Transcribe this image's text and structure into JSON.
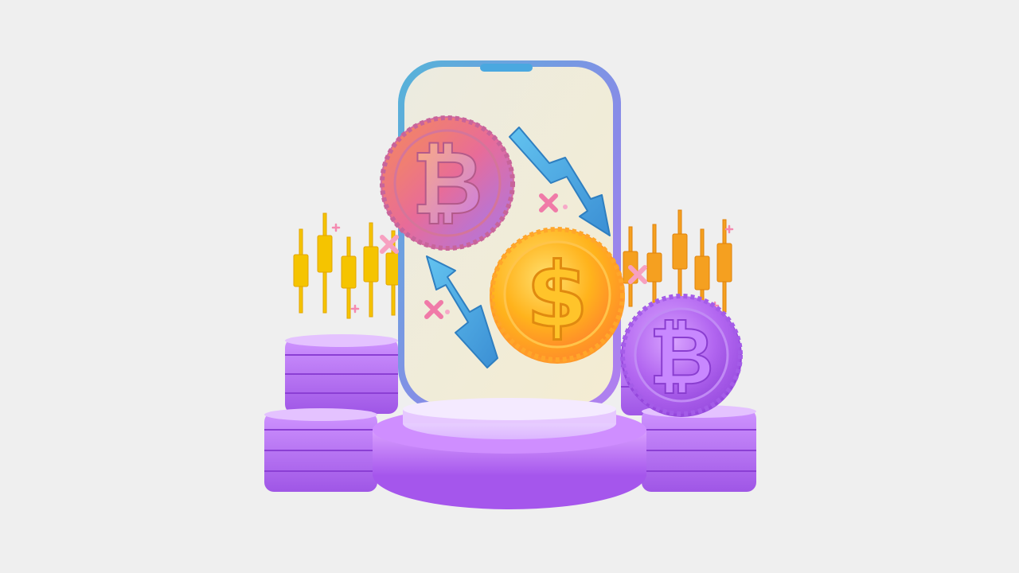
{
  "scene": {
    "background_color": "#efefef",
    "subject": "crypto-exchange-illustration",
    "phone": {
      "screen_color": "#f0ead6",
      "frame_color": "#5aa8d8"
    },
    "coins": [
      {
        "name": "bitcoin",
        "symbol": "B",
        "color": "#e0709a"
      },
      {
        "name": "dollar",
        "symbol": "$",
        "color": "#ffb020"
      },
      {
        "name": "bitcoin",
        "symbol": "B",
        "color": "#b866f0"
      }
    ],
    "arrows": [
      {
        "direction": "down",
        "color": "#4aa8e0"
      },
      {
        "direction": "up",
        "color": "#4aa8e0"
      }
    ],
    "candlesticks": [
      {
        "side": "left",
        "color": "#f5c400"
      },
      {
        "side": "right",
        "color": "#f5a020"
      }
    ],
    "coin_stacks_color": "#b266ee",
    "pedestal_color": "#c070f8"
  }
}
